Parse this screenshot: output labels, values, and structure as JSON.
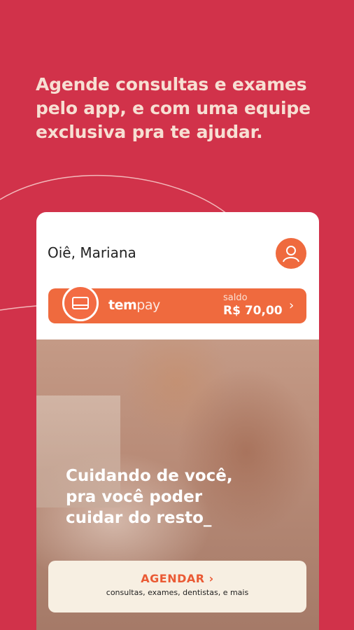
{
  "headline": {
    "line1": "Agende consultas e exames",
    "line2": "pelo app, e com uma equipe",
    "line3": "exclusiva pra te ajudar."
  },
  "app": {
    "greeting": "Oiê, Mariana",
    "avatar_icon": "user-icon",
    "tempay": {
      "brand_part1": "tem",
      "brand_part2": "pay",
      "card_icon": "credit-card-icon",
      "balance_label": "saldo",
      "balance_value": "R$ 70,00",
      "chevron": "›"
    },
    "hero": {
      "line1": "Cuidando de você,",
      "line2": "pra você poder",
      "line3": "cuidar do resto_"
    },
    "schedule": {
      "label": "AGENDAR",
      "chevron": "›",
      "subtitle": "consultas, exames, dentistas, e mais"
    }
  },
  "colors": {
    "background": "#d1324a",
    "accent": "#ef6a3e",
    "headline_text": "#f7dfd3",
    "schedule_card": "#f7efe2"
  }
}
